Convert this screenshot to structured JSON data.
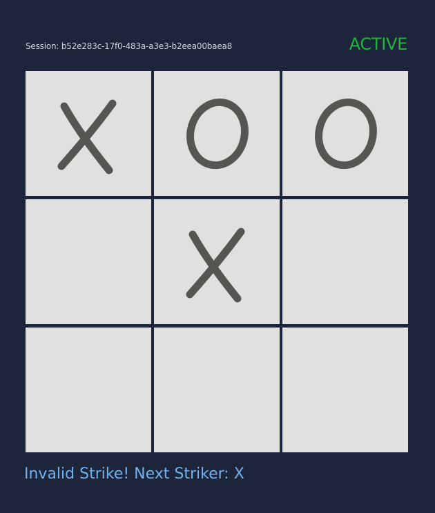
{
  "header": {
    "session_text": "Session: b52e283c-17f0-483a-a3e3-b2eea00baea8",
    "status": "ACTIVE"
  },
  "board": {
    "cells": [
      "X",
      "O",
      "O",
      "",
      "X",
      "",
      "",
      "",
      ""
    ]
  },
  "footer": {
    "message": "Invalid Strike! Next Striker: X"
  },
  "colors": {
    "background": "#1c253a",
    "cell": "#e0e0df",
    "mark": "#555552",
    "status": "#22b53a",
    "message": "#6fb1ee"
  }
}
